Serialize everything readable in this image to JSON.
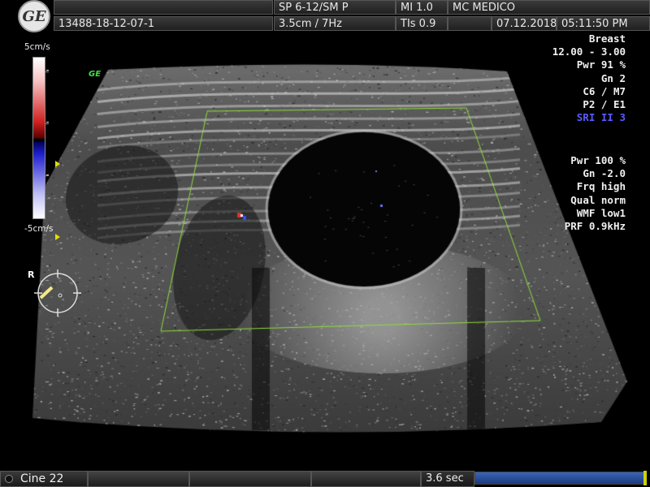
{
  "header": {
    "patient_id": "13488-18-12-07-1",
    "probe": "SP 6-12/SM P",
    "depth_freq": "3.5cm / 7Hz",
    "mi": "MI  1.0",
    "tis": "TIs  0.9",
    "institution": "MC MEDICO",
    "date": "07.12.2018",
    "time": "05:11:50 PM"
  },
  "brand_logo": "GE",
  "image_tag": "GE",
  "params_top": [
    "Breast",
    "12.00 - 3.00",
    "Pwr  91 %",
    "Gn  2",
    "C6 / M7",
    "P2 / E1",
    "SRI II 3"
  ],
  "params_color_flow": [
    "Pwr 100 %",
    "Gn -2.0",
    "Frq high",
    "Qual norm",
    "WMF low1",
    "PRF  0.9kHz"
  ],
  "colorbar": {
    "top_label": "5cm/s",
    "bottom_label": "-5cm/s"
  },
  "orientation_label": "R",
  "bottom": {
    "cine_label": "Cine 22",
    "time_label": "3.6 sec",
    "progress": 1.0
  },
  "colors": {
    "roi_box": "#8fdc3a",
    "highlight_param": "#5a5aff",
    "progress": "#2f56a6"
  }
}
